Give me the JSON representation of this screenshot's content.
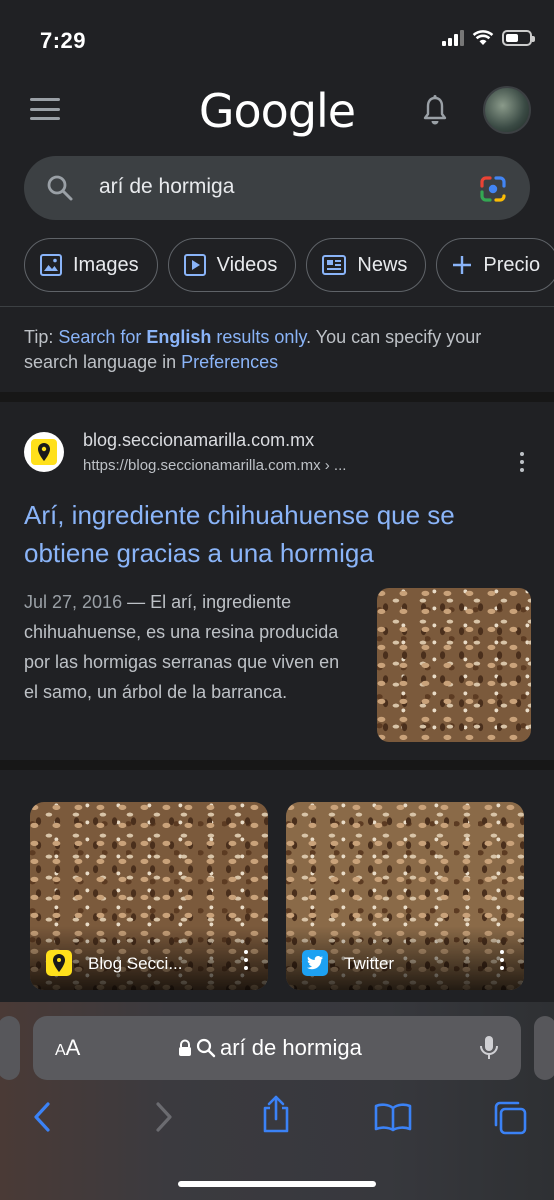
{
  "status_bar": {
    "time": "7:29"
  },
  "header": {
    "logo": "Google",
    "icons": [
      "menu-icon",
      "bell-icon"
    ]
  },
  "search": {
    "query": "arí de hormiga",
    "icons": [
      "search-icon",
      "google-lens-icon"
    ]
  },
  "chips": [
    {
      "label": "Images",
      "icon": "image-icon"
    },
    {
      "label": "Videos",
      "icon": "play-icon"
    },
    {
      "label": "News",
      "icon": "newspaper-icon"
    },
    {
      "label": "Precio",
      "icon": "plus-icon"
    }
  ],
  "tip": {
    "prefix": "Tip: ",
    "link1": "Search for ",
    "link1_bold": "English",
    "link1_suffix": " results only",
    "middle": ". You can specify your search language in ",
    "link2": "Preferences"
  },
  "result": {
    "site_name": "blog.seccionamarilla.com.mx",
    "site_url": "https://blog.seccionamarilla.com.mx › ...",
    "title": "Arí, ingrediente chihuahuense que se obtiene gracias a una hormiga",
    "date": "Jul 27, 2016",
    "separator": " — ",
    "snippet": "El arí, ingrediente chihuahuense, es una resina producida por las hormigas serranas que viven en el samo, un árbol de la barranca."
  },
  "images": [
    {
      "label": "Blog Secci...",
      "icon": "seccion-amarilla-icon"
    },
    {
      "label": "Twitter",
      "icon": "twitter-icon"
    }
  ],
  "safari": {
    "text_size_label_small": "A",
    "text_size_label_large": "A",
    "address": "arí de hormiga",
    "icons": [
      "back-icon",
      "forward-icon",
      "share-icon",
      "bookmarks-icon",
      "tabs-icon"
    ]
  },
  "colors": {
    "background": "#202124",
    "link": "#8ab4f8",
    "chip_border": "#5f6368",
    "safari_blue": "#3b82f6"
  }
}
